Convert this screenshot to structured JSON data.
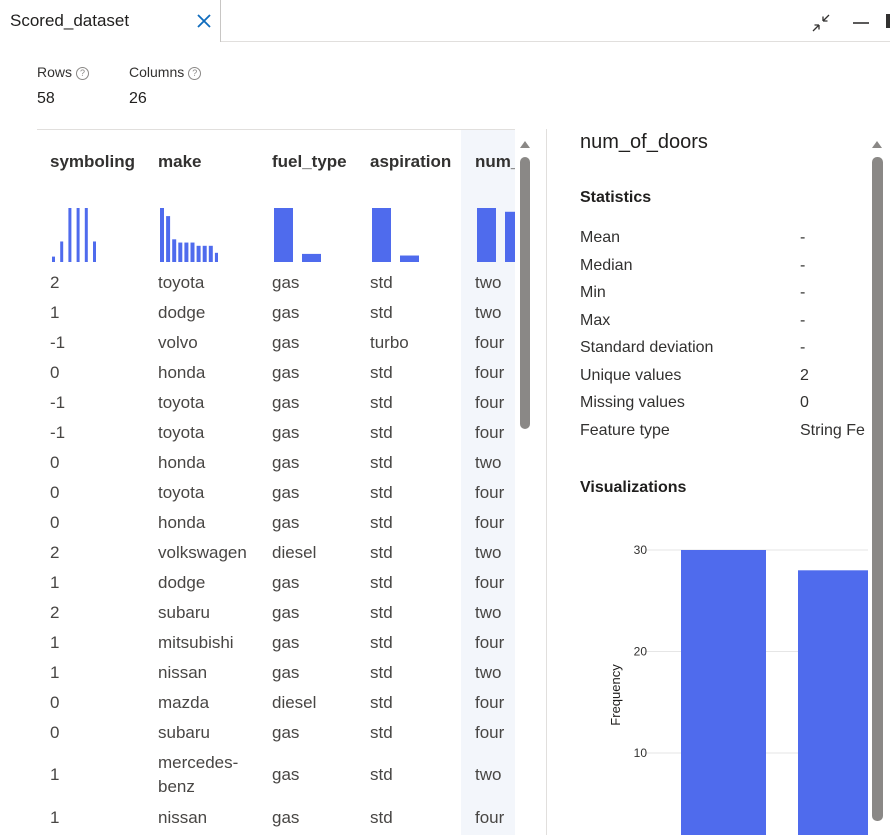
{
  "tab": {
    "title": "Scored_dataset"
  },
  "summary": {
    "rows_label": "Rows",
    "rows_value": "58",
    "columns_label": "Columns",
    "columns_value": "26"
  },
  "table": {
    "columns": [
      "symboling",
      "make",
      "fuel_type",
      "aspiration",
      "num_"
    ],
    "rows": [
      [
        "2",
        "toyota",
        "gas",
        "std",
        "two"
      ],
      [
        "1",
        "dodge",
        "gas",
        "std",
        "two"
      ],
      [
        "-1",
        "volvo",
        "gas",
        "turbo",
        "four"
      ],
      [
        "0",
        "honda",
        "gas",
        "std",
        "four"
      ],
      [
        "-1",
        "toyota",
        "gas",
        "std",
        "four"
      ],
      [
        "-1",
        "toyota",
        "gas",
        "std",
        "four"
      ],
      [
        "0",
        "honda",
        "gas",
        "std",
        "two"
      ],
      [
        "0",
        "toyota",
        "gas",
        "std",
        "four"
      ],
      [
        "0",
        "honda",
        "gas",
        "std",
        "four"
      ],
      [
        "2",
        "volkswagen",
        "diesel",
        "std",
        "two"
      ],
      [
        "1",
        "dodge",
        "gas",
        "std",
        "four"
      ],
      [
        "2",
        "subaru",
        "gas",
        "std",
        "two"
      ],
      [
        "1",
        "mitsubishi",
        "gas",
        "std",
        "four"
      ],
      [
        "1",
        "nissan",
        "gas",
        "std",
        "two"
      ],
      [
        "0",
        "mazda",
        "diesel",
        "std",
        "four"
      ],
      [
        "0",
        "subaru",
        "gas",
        "std",
        "four"
      ],
      [
        "1",
        "mercedes-benz",
        "gas",
        "std",
        "two"
      ],
      [
        "1",
        "nissan",
        "gas",
        "std",
        "four"
      ]
    ],
    "mini_histograms": {
      "symboling": [
        0.1,
        0.38,
        1.0,
        1.0,
        1.0,
        0.38
      ],
      "make": [
        1.0,
        0.85,
        0.42,
        0.36,
        0.36,
        0.36,
        0.3,
        0.3,
        0.3,
        0.17
      ],
      "fuel_type": [
        1.0,
        0.15
      ],
      "aspiration": [
        1.0,
        0.12
      ],
      "num_": [
        1.0,
        0.93
      ]
    }
  },
  "detail": {
    "column_name": "num_of_doors",
    "statistics_heading": "Statistics",
    "stats": [
      {
        "label": "Mean",
        "value": "-"
      },
      {
        "label": "Median",
        "value": "-"
      },
      {
        "label": "Min",
        "value": "-"
      },
      {
        "label": "Max",
        "value": "-"
      },
      {
        "label": "Standard deviation",
        "value": "-"
      },
      {
        "label": "Unique values",
        "value": "2"
      },
      {
        "label": "Missing values",
        "value": "0"
      },
      {
        "label": "Feature type",
        "value": "String Fe"
      }
    ],
    "visualizations_heading": "Visualizations"
  },
  "colors": {
    "accent": "#4f6bed",
    "scrollbar": "#8a8886",
    "highlight": "#f3f6fb"
  },
  "icons": [
    "close-icon",
    "collapse-icon",
    "minimize-icon",
    "help-icon",
    "scroll-up-arrow-icon"
  ],
  "chart_data": {
    "type": "bar",
    "title": "",
    "ylabel": "Frequency",
    "xlabel": "",
    "yticks": [
      10,
      20,
      30
    ],
    "series": [
      {
        "values": [
          30,
          28
        ]
      }
    ],
    "color": "#4f6bed",
    "grid": true
  }
}
